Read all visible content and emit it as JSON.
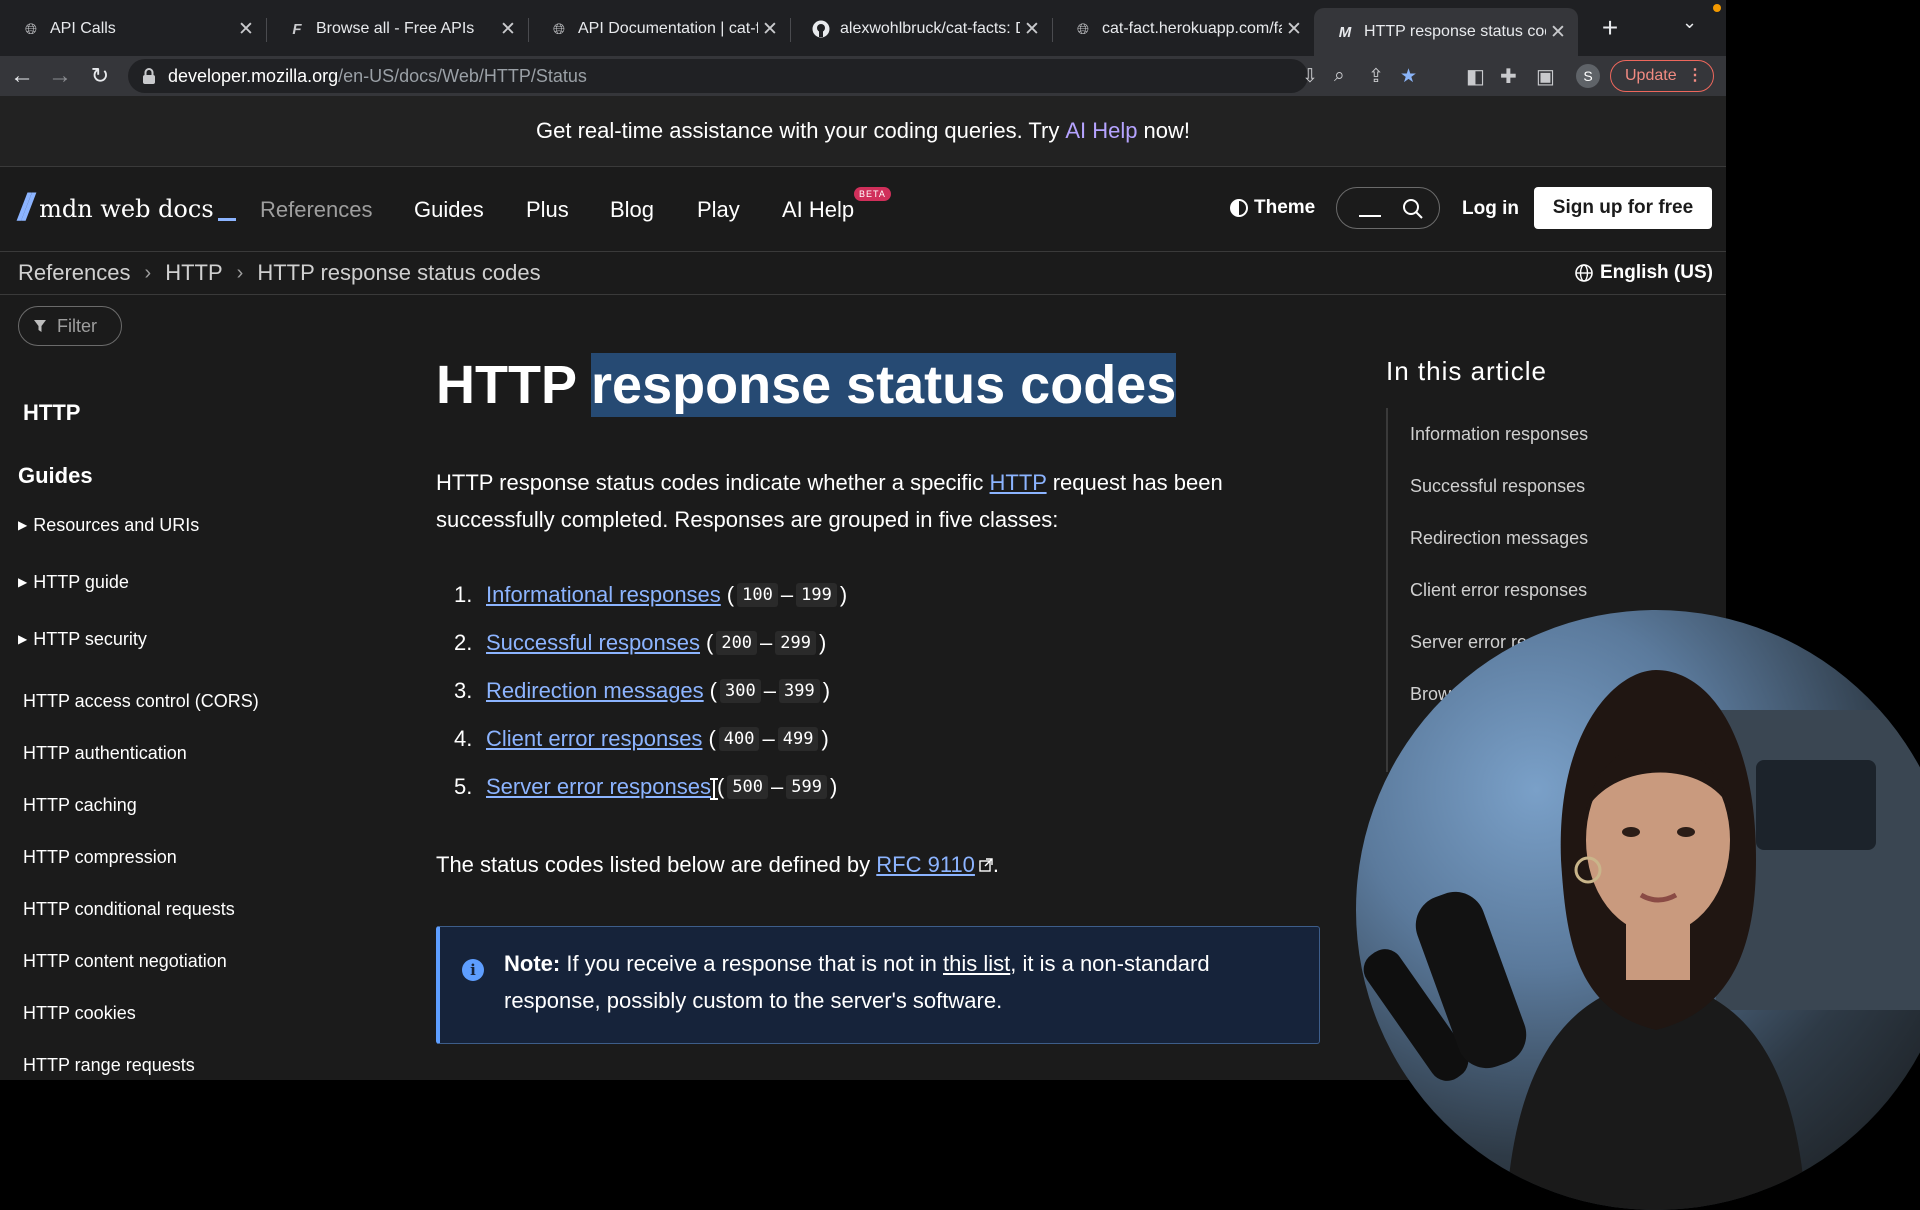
{
  "tabs": [
    {
      "title": "API Calls",
      "icon": "globe-icon"
    },
    {
      "title": "Browse all - Free APIs",
      "icon": "freeapis-icon"
    },
    {
      "title": "API Documentation | cat-fa",
      "icon": "globe-icon"
    },
    {
      "title": "alexwohlbruck/cat-facts: D",
      "icon": "github-icon"
    },
    {
      "title": "cat-fact.herokuapp.com/fa",
      "icon": "globe-icon"
    },
    {
      "title": "HTTP response status code",
      "icon": "mdn-icon",
      "active": true
    }
  ],
  "address_bar": {
    "host": "developer.mozilla.org",
    "path": "/en-US/docs/Web/HTTP/Status"
  },
  "profile_initial": "S",
  "update_label": "Update",
  "banner": {
    "before": "Get real-time assistance with your coding queries. Try",
    "link": "AI Help",
    "after": "now!"
  },
  "mdn_nav": {
    "logo_text": "mdn web docs",
    "items": [
      "References",
      "Guides",
      "Plus",
      "Blog",
      "Play",
      "AI Help"
    ],
    "beta": "BETA",
    "theme": "Theme",
    "login": "Log in",
    "signup": "Sign up for free"
  },
  "breadcrumb": [
    "References",
    "HTTP",
    "HTTP response status codes"
  ],
  "language": "English (US)",
  "sidebar": {
    "filter_placeholder": "Filter",
    "heading": "HTTP",
    "guides": "Guides",
    "collapsible": [
      "Resources and URIs",
      "HTTP guide",
      "HTTP security"
    ],
    "items": [
      "HTTP access control (CORS)",
      "HTTP authentication",
      "HTTP caching",
      "HTTP compression",
      "HTTP conditional requests",
      "HTTP content negotiation",
      "HTTP cookies",
      "HTTP range requests"
    ]
  },
  "article": {
    "title_plain": "HTTP",
    "title_highlight": "response status codes",
    "intro_before": "HTTP response status codes indicate whether a specific",
    "intro_link": "HTTP",
    "intro_after": "request has been successfully completed. Responses are grouped in five classes:",
    "classes": [
      {
        "num": "1.",
        "label": "Informational responses",
        "from": "100",
        "to": "199"
      },
      {
        "num": "2.",
        "label": "Successful responses",
        "from": "200",
        "to": "299"
      },
      {
        "num": "3.",
        "label": "Redirection messages",
        "from": "300",
        "to": "399"
      },
      {
        "num": "4.",
        "label": "Client error responses",
        "from": "400",
        "to": "499"
      },
      {
        "num": "5.",
        "label": "Server error responses",
        "from": "500",
        "to": "599"
      }
    ],
    "rfc_before": "The status codes listed below are defined by",
    "rfc_link": "RFC 9110",
    "note_label": "Note:",
    "note_before": "If you receive a response that is not in",
    "note_link": "this list",
    "note_after": ", it is a non-standard response, possibly custom to the server's software."
  },
  "toc": {
    "title": "In this article",
    "items": [
      "Information responses",
      "Successful responses",
      "Redirection messages",
      "Client error responses",
      "Server error re",
      "Brow"
    ]
  },
  "colors": {
    "link": "#8cb4ff",
    "highlight": "#264a73",
    "note_border": "#5e9eff",
    "update": "#f28b82"
  }
}
